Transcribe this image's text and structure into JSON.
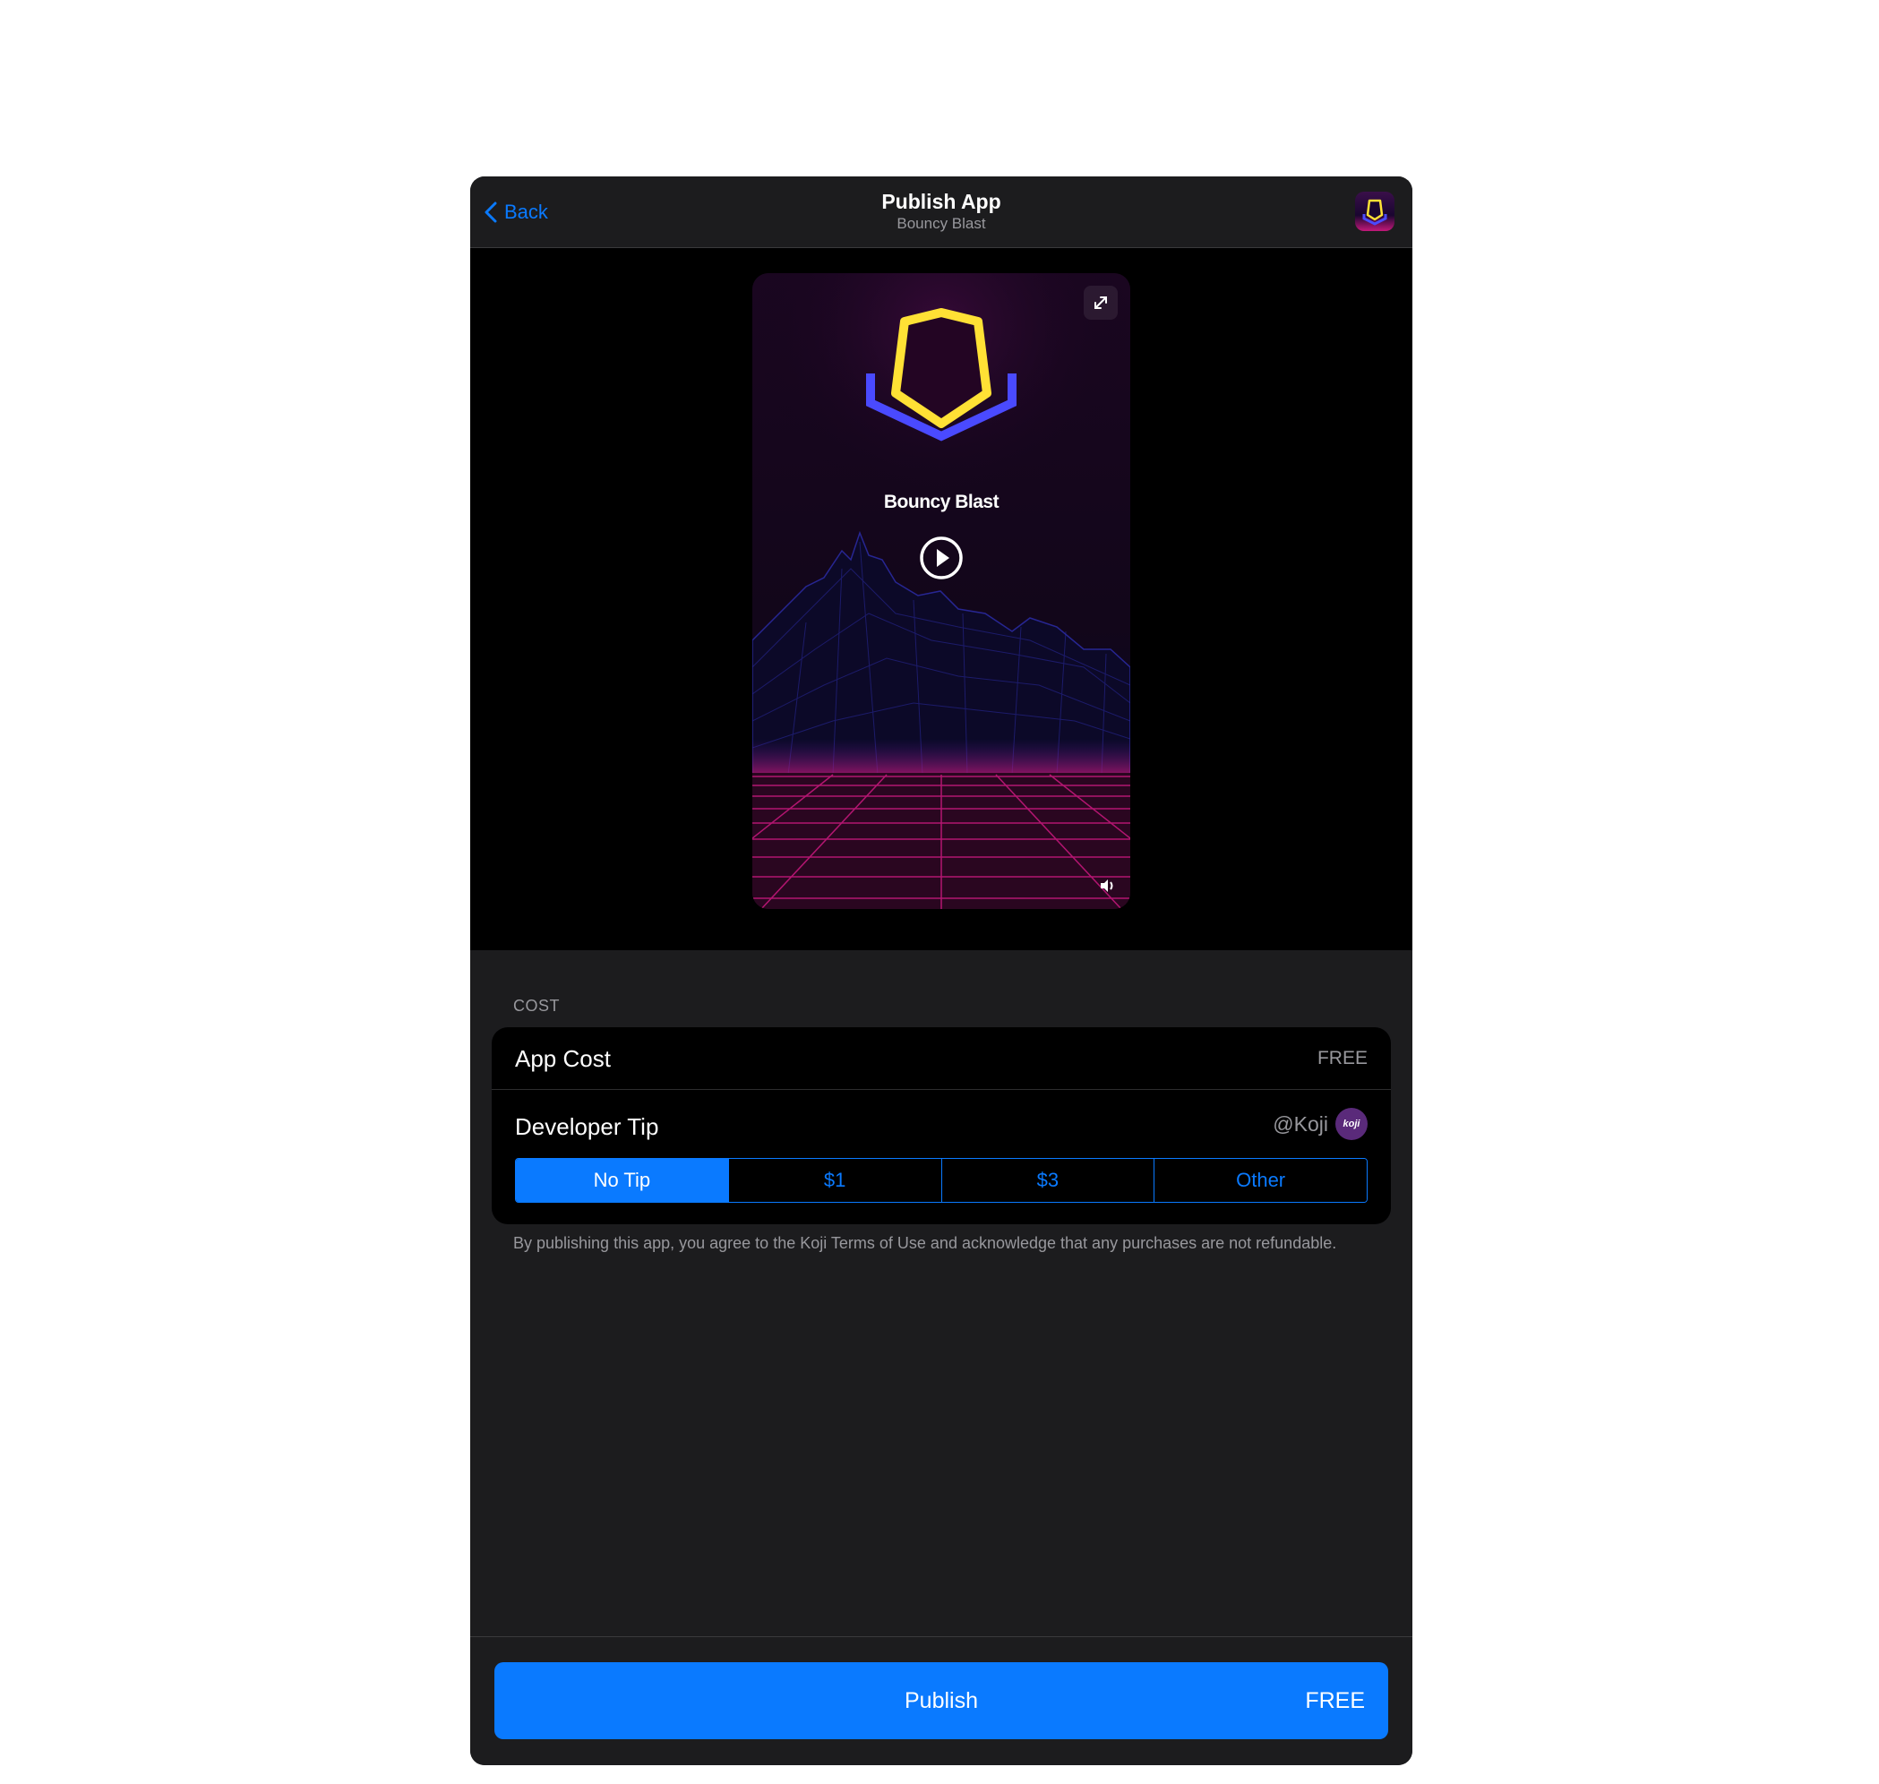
{
  "header": {
    "back_label": "Back",
    "title": "Publish App",
    "subtitle": "Bouncy Blast"
  },
  "preview": {
    "game_title": "Bouncy Blast"
  },
  "cost": {
    "section_label": "COST",
    "app_cost_label": "App Cost",
    "app_cost_value": "FREE",
    "developer_tip_label": "Developer Tip",
    "developer_handle": "@Koji",
    "developer_avatar_text": "koji",
    "tip_options": [
      {
        "label": "No Tip",
        "selected": true
      },
      {
        "label": "$1",
        "selected": false
      },
      {
        "label": "$3",
        "selected": false
      },
      {
        "label": "Other",
        "selected": false
      }
    ]
  },
  "terms_text": "By publishing this app, you agree to the Koji Terms of Use and acknowledge that any purchases are not refundable.",
  "footer": {
    "publish_label": "Publish",
    "publish_price": "FREE"
  },
  "colors": {
    "accent": "#0a7aff",
    "background": "#1c1c1e",
    "card": "#000000",
    "shield_yellow": "#ffe135",
    "shield_blue": "#4a4aff",
    "grid_magenta": "#c2187a"
  }
}
